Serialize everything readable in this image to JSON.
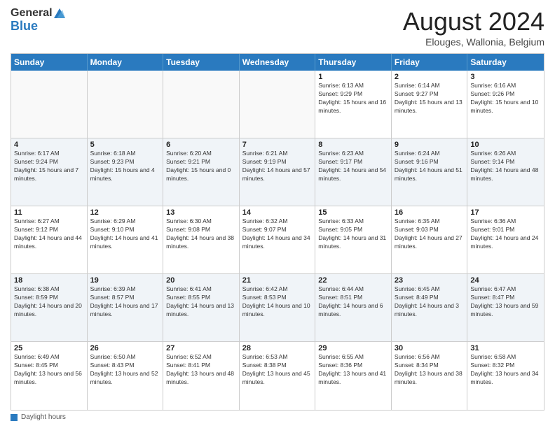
{
  "header": {
    "logo_general": "General",
    "logo_blue": "Blue",
    "month_year": "August 2024",
    "location": "Elouges, Wallonia, Belgium"
  },
  "days_of_week": [
    "Sunday",
    "Monday",
    "Tuesday",
    "Wednesday",
    "Thursday",
    "Friday",
    "Saturday"
  ],
  "footer_label": "Daylight hours",
  "weeks": [
    [
      {
        "day": "",
        "sunrise": "",
        "sunset": "",
        "daylight": "",
        "empty": true
      },
      {
        "day": "",
        "sunrise": "",
        "sunset": "",
        "daylight": "",
        "empty": true
      },
      {
        "day": "",
        "sunrise": "",
        "sunset": "",
        "daylight": "",
        "empty": true
      },
      {
        "day": "",
        "sunrise": "",
        "sunset": "",
        "daylight": "",
        "empty": true
      },
      {
        "day": "1",
        "sunrise": "Sunrise: 6:13 AM",
        "sunset": "Sunset: 9:29 PM",
        "daylight": "Daylight: 15 hours and 16 minutes.",
        "empty": false
      },
      {
        "day": "2",
        "sunrise": "Sunrise: 6:14 AM",
        "sunset": "Sunset: 9:27 PM",
        "daylight": "Daylight: 15 hours and 13 minutes.",
        "empty": false
      },
      {
        "day": "3",
        "sunrise": "Sunrise: 6:16 AM",
        "sunset": "Sunset: 9:26 PM",
        "daylight": "Daylight: 15 hours and 10 minutes.",
        "empty": false
      }
    ],
    [
      {
        "day": "4",
        "sunrise": "Sunrise: 6:17 AM",
        "sunset": "Sunset: 9:24 PM",
        "daylight": "Daylight: 15 hours and 7 minutes.",
        "empty": false
      },
      {
        "day": "5",
        "sunrise": "Sunrise: 6:18 AM",
        "sunset": "Sunset: 9:23 PM",
        "daylight": "Daylight: 15 hours and 4 minutes.",
        "empty": false
      },
      {
        "day": "6",
        "sunrise": "Sunrise: 6:20 AM",
        "sunset": "Sunset: 9:21 PM",
        "daylight": "Daylight: 15 hours and 0 minutes.",
        "empty": false
      },
      {
        "day": "7",
        "sunrise": "Sunrise: 6:21 AM",
        "sunset": "Sunset: 9:19 PM",
        "daylight": "Daylight: 14 hours and 57 minutes.",
        "empty": false
      },
      {
        "day": "8",
        "sunrise": "Sunrise: 6:23 AM",
        "sunset": "Sunset: 9:17 PM",
        "daylight": "Daylight: 14 hours and 54 minutes.",
        "empty": false
      },
      {
        "day": "9",
        "sunrise": "Sunrise: 6:24 AM",
        "sunset": "Sunset: 9:16 PM",
        "daylight": "Daylight: 14 hours and 51 minutes.",
        "empty": false
      },
      {
        "day": "10",
        "sunrise": "Sunrise: 6:26 AM",
        "sunset": "Sunset: 9:14 PM",
        "daylight": "Daylight: 14 hours and 48 minutes.",
        "empty": false
      }
    ],
    [
      {
        "day": "11",
        "sunrise": "Sunrise: 6:27 AM",
        "sunset": "Sunset: 9:12 PM",
        "daylight": "Daylight: 14 hours and 44 minutes.",
        "empty": false
      },
      {
        "day": "12",
        "sunrise": "Sunrise: 6:29 AM",
        "sunset": "Sunset: 9:10 PM",
        "daylight": "Daylight: 14 hours and 41 minutes.",
        "empty": false
      },
      {
        "day": "13",
        "sunrise": "Sunrise: 6:30 AM",
        "sunset": "Sunset: 9:08 PM",
        "daylight": "Daylight: 14 hours and 38 minutes.",
        "empty": false
      },
      {
        "day": "14",
        "sunrise": "Sunrise: 6:32 AM",
        "sunset": "Sunset: 9:07 PM",
        "daylight": "Daylight: 14 hours and 34 minutes.",
        "empty": false
      },
      {
        "day": "15",
        "sunrise": "Sunrise: 6:33 AM",
        "sunset": "Sunset: 9:05 PM",
        "daylight": "Daylight: 14 hours and 31 minutes.",
        "empty": false
      },
      {
        "day": "16",
        "sunrise": "Sunrise: 6:35 AM",
        "sunset": "Sunset: 9:03 PM",
        "daylight": "Daylight: 14 hours and 27 minutes.",
        "empty": false
      },
      {
        "day": "17",
        "sunrise": "Sunrise: 6:36 AM",
        "sunset": "Sunset: 9:01 PM",
        "daylight": "Daylight: 14 hours and 24 minutes.",
        "empty": false
      }
    ],
    [
      {
        "day": "18",
        "sunrise": "Sunrise: 6:38 AM",
        "sunset": "Sunset: 8:59 PM",
        "daylight": "Daylight: 14 hours and 20 minutes.",
        "empty": false
      },
      {
        "day": "19",
        "sunrise": "Sunrise: 6:39 AM",
        "sunset": "Sunset: 8:57 PM",
        "daylight": "Daylight: 14 hours and 17 minutes.",
        "empty": false
      },
      {
        "day": "20",
        "sunrise": "Sunrise: 6:41 AM",
        "sunset": "Sunset: 8:55 PM",
        "daylight": "Daylight: 14 hours and 13 minutes.",
        "empty": false
      },
      {
        "day": "21",
        "sunrise": "Sunrise: 6:42 AM",
        "sunset": "Sunset: 8:53 PM",
        "daylight": "Daylight: 14 hours and 10 minutes.",
        "empty": false
      },
      {
        "day": "22",
        "sunrise": "Sunrise: 6:44 AM",
        "sunset": "Sunset: 8:51 PM",
        "daylight": "Daylight: 14 hours and 6 minutes.",
        "empty": false
      },
      {
        "day": "23",
        "sunrise": "Sunrise: 6:45 AM",
        "sunset": "Sunset: 8:49 PM",
        "daylight": "Daylight: 14 hours and 3 minutes.",
        "empty": false
      },
      {
        "day": "24",
        "sunrise": "Sunrise: 6:47 AM",
        "sunset": "Sunset: 8:47 PM",
        "daylight": "Daylight: 13 hours and 59 minutes.",
        "empty": false
      }
    ],
    [
      {
        "day": "25",
        "sunrise": "Sunrise: 6:49 AM",
        "sunset": "Sunset: 8:45 PM",
        "daylight": "Daylight: 13 hours and 56 minutes.",
        "empty": false
      },
      {
        "day": "26",
        "sunrise": "Sunrise: 6:50 AM",
        "sunset": "Sunset: 8:43 PM",
        "daylight": "Daylight: 13 hours and 52 minutes.",
        "empty": false
      },
      {
        "day": "27",
        "sunrise": "Sunrise: 6:52 AM",
        "sunset": "Sunset: 8:41 PM",
        "daylight": "Daylight: 13 hours and 48 minutes.",
        "empty": false
      },
      {
        "day": "28",
        "sunrise": "Sunrise: 6:53 AM",
        "sunset": "Sunset: 8:38 PM",
        "daylight": "Daylight: 13 hours and 45 minutes.",
        "empty": false
      },
      {
        "day": "29",
        "sunrise": "Sunrise: 6:55 AM",
        "sunset": "Sunset: 8:36 PM",
        "daylight": "Daylight: 13 hours and 41 minutes.",
        "empty": false
      },
      {
        "day": "30",
        "sunrise": "Sunrise: 6:56 AM",
        "sunset": "Sunset: 8:34 PM",
        "daylight": "Daylight: 13 hours and 38 minutes.",
        "empty": false
      },
      {
        "day": "31",
        "sunrise": "Sunrise: 6:58 AM",
        "sunset": "Sunset: 8:32 PM",
        "daylight": "Daylight: 13 hours and 34 minutes.",
        "empty": false
      }
    ]
  ]
}
